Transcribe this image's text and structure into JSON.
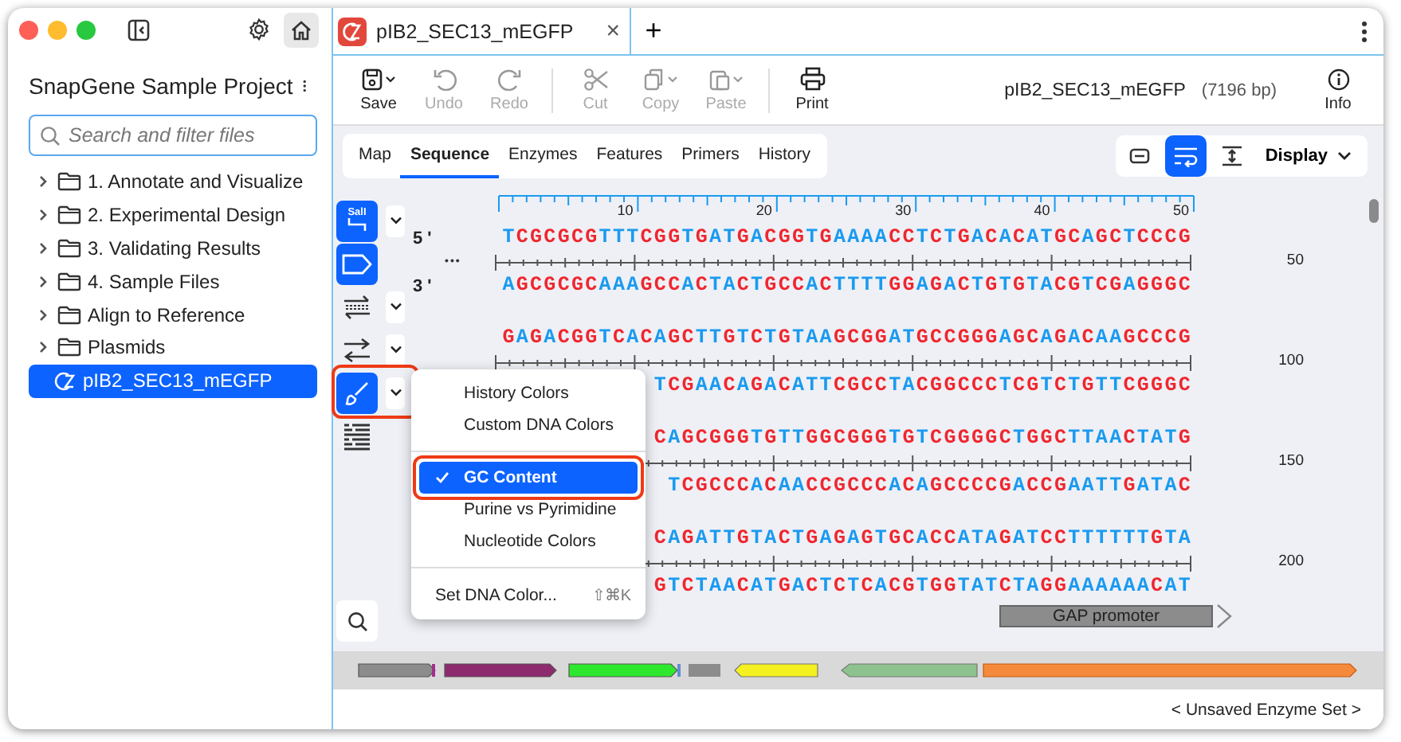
{
  "sidebar": {
    "title": "SnapGene Sample Project",
    "search": {
      "placeholder": "Search and filter files"
    },
    "items": [
      {
        "kind": "folder",
        "label": "1. Annotate and Visualize",
        "expanded": false,
        "selected": false
      },
      {
        "kind": "folder",
        "label": "2. Experimental Design",
        "expanded": false,
        "selected": false
      },
      {
        "kind": "folder",
        "label": "3. Validating Results",
        "expanded": false,
        "selected": false
      },
      {
        "kind": "folder",
        "label": "4. Sample Files",
        "expanded": false,
        "selected": false
      },
      {
        "kind": "folder",
        "label": "Align to Reference",
        "expanded": false,
        "selected": false
      },
      {
        "kind": "folder",
        "label": "Plasmids",
        "expanded": false,
        "selected": false
      },
      {
        "kind": "file",
        "label": "pIB2_SEC13_mEGFP",
        "selected": true
      }
    ]
  },
  "doc_tabs": [
    {
      "title": "pIB2_SEC13_mEGFP",
      "close": "×",
      "selected": true
    }
  ],
  "new_tab": "+",
  "toolbar": {
    "groups": [
      [
        {
          "kind": "save",
          "label": "Save",
          "disabled": false,
          "menu": true
        },
        {
          "kind": "undo",
          "label": "Undo",
          "disabled": true,
          "menu": false
        },
        {
          "kind": "redo",
          "label": "Redo",
          "disabled": true,
          "menu": false
        }
      ],
      [
        {
          "kind": "cut",
          "label": "Cut",
          "disabled": true,
          "menu": false
        },
        {
          "kind": "copy",
          "label": "Copy",
          "disabled": true,
          "menu": true
        },
        {
          "kind": "paste",
          "label": "Paste",
          "disabled": true,
          "menu": true
        }
      ],
      [
        {
          "kind": "print",
          "label": "Print",
          "disabled": false,
          "menu": false
        }
      ]
    ],
    "document_name": "pIB2_SEC13_mEGFP",
    "document_length": "(7196 bp)",
    "info": "Info"
  },
  "view_tabs": [
    {
      "label": "Map",
      "selected": false
    },
    {
      "label": "Sequence",
      "selected": true
    },
    {
      "label": "Enzymes",
      "selected": false
    },
    {
      "label": "Features",
      "selected": false
    },
    {
      "label": "Primers",
      "selected": false
    },
    {
      "label": "History",
      "selected": false
    }
  ],
  "view_buttons": [
    {
      "kind": "collapse",
      "selected": false
    },
    {
      "kind": "wrap",
      "selected": true
    },
    {
      "kind": "fit",
      "selected": false
    }
  ],
  "display_menu": "Display",
  "tools": [
    {
      "kind": "enzymes",
      "label": "SalI",
      "selected": true,
      "dropdown": true,
      "highlighted": false
    },
    {
      "kind": "features",
      "selected": true,
      "dropdown": false,
      "highlighted": false
    },
    {
      "kind": "strands",
      "selected": false,
      "dropdown": true,
      "highlighted": false
    },
    {
      "kind": "direction",
      "selected": false,
      "dropdown": true,
      "highlighted": false
    },
    {
      "kind": "colors",
      "selected": true,
      "dropdown": true,
      "highlighted": true
    },
    {
      "kind": "translation",
      "selected": false,
      "dropdown": false,
      "highlighted": false
    }
  ],
  "sequence": {
    "ruler_ticks": [
      "10",
      "20",
      "30",
      "40",
      "50"
    ],
    "five_prime": "5 '",
    "three_prime": "3 '",
    "ellipsis": "•••",
    "rows": [
      {
        "top": "TCGCGCGTTTCGGTGATGACGGTGAAAACCTCTGACACATGCAGCTCCCG",
        "bottom": "AGCGCGCAAAGCCACTACTGCCACTTTTGGAGACTGTGTACGTCGAGGGC",
        "number": "50"
      },
      {
        "top": "GAGACGGTCACAGCTTGTCTGTAAGCGGATGCCGGGAGCAGACAAGCCCG",
        "bottom": "TCGAACAGACATTCGCCTACGGCCCTCGTCTGTTCGGGC",
        "number": "100"
      },
      {
        "top": "CAGCGGGTGTTGGCGGGTGTCGGGGCTGGCTTAACTATG",
        "bottom": "TCGCCCACAACCGCCCACAGCCCCGACCGAATTGATAC",
        "number": "150"
      },
      {
        "top": "CAGATTGTACTGAGAGTGCACCATAGATCCTTTTTTGTA",
        "bottom": "GTCTAACATGACTCTCACGTGGTATCTAGGAAAAAACAT",
        "number": "200"
      }
    ],
    "features": [
      {
        "label": "GAP promoter",
        "color": "#8c8c8c"
      }
    ]
  },
  "color_menu": [
    {
      "kind": "item",
      "label": "History Colors",
      "checked": false,
      "selected": false,
      "highlighted": false
    },
    {
      "kind": "item",
      "label": "Custom DNA Colors",
      "checked": false,
      "selected": false,
      "highlighted": false
    },
    {
      "kind": "divider"
    },
    {
      "kind": "item",
      "label": "GC Content",
      "checked": true,
      "selected": true,
      "highlighted": true
    },
    {
      "kind": "item",
      "label": "Purine vs Pyrimidine",
      "checked": false,
      "selected": false,
      "highlighted": false
    },
    {
      "kind": "item",
      "label": "Nucleotide Colors",
      "checked": false,
      "selected": false,
      "highlighted": false
    },
    {
      "kind": "divider"
    },
    {
      "kind": "command",
      "label": "Set DNA Color...",
      "shortcut": "⇧⌘K"
    }
  ],
  "status_bar": "< Unsaved Enzyme Set >"
}
